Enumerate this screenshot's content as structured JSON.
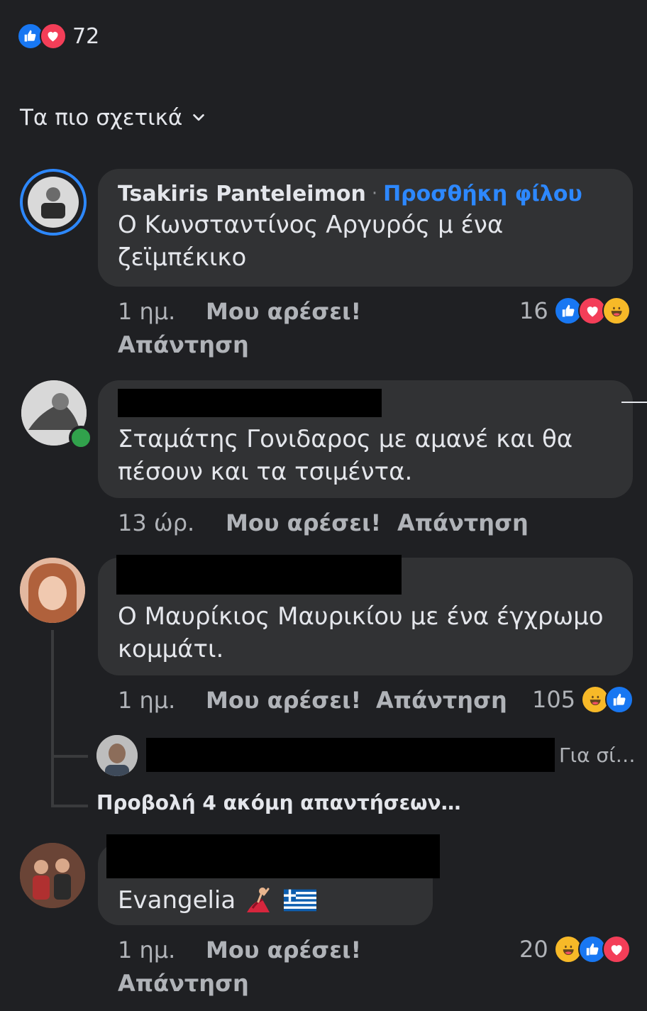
{
  "summary": {
    "count": "72",
    "reactions": [
      "like-icon",
      "love-icon"
    ]
  },
  "sort": {
    "label": "Τα πιο σχετικά"
  },
  "comments": [
    {
      "author": "Tsakiris Panteleimon",
      "add_friend": "Προσθήκη φίλου",
      "text_line1": "Ο Κωνσταντίνος Αργυρός μ ένα",
      "text_line2": "ζεϊμπέκικο",
      "time": "1 ημ.",
      "like": "Μου αρέσει!",
      "reply": "Απάντηση",
      "reaction_count": "16",
      "reactions": [
        "like-icon",
        "love-icon",
        "haha-icon"
      ]
    },
    {
      "text_line1": "Σταμάτης Γονιδαρος με αμανέ και θα",
      "text_line2": "πέσουν και τα τσιμέντα.",
      "time": "13 ώρ.",
      "like": "Μου αρέσει!",
      "reply": "Απάντηση",
      "online": true
    },
    {
      "text_line1": "Ο Μαυρίκιος Μαυρικίου με ένα έγχρωμο",
      "text_line2": "κομμάτι.",
      "time": "1 ημ.",
      "like": "Μου αρέσει!",
      "reply": "Απάντηση",
      "reaction_count": "105",
      "reactions": [
        "haha-icon",
        "like-icon"
      ],
      "reply_preview": "Για σί…",
      "view_more": "Προβολή 4 ακόμη απαντήσεων…"
    },
    {
      "text_line1": "Evangelia",
      "emoji": [
        "dancer-emoji",
        "greek-flag-emoji"
      ],
      "time": "1 ημ.",
      "like": "Μου αρέσει!",
      "reply": "Απάντηση",
      "reaction_count": "20",
      "reactions": [
        "haha-icon",
        "like-icon",
        "love-icon"
      ]
    }
  ],
  "colors": {
    "background": "#1f2023",
    "bubble": "#313234",
    "link": "#2d88ff",
    "like": "#1877f2",
    "love": "#f33e58",
    "haha": "#f7b928",
    "online": "#31a24c"
  }
}
